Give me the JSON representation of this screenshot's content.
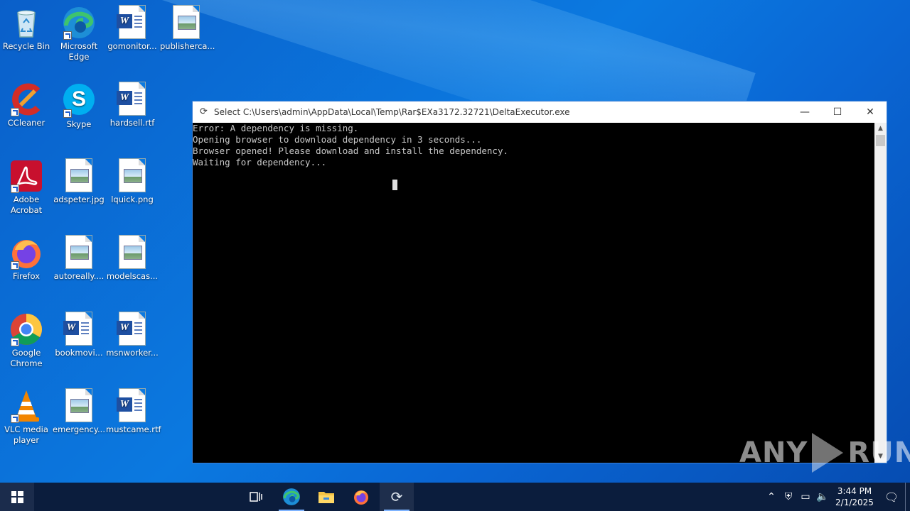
{
  "desktop": {
    "icons": [
      {
        "label": "Recycle Bin"
      },
      {
        "label": "Microsoft Edge"
      },
      {
        "label": "gomonitor..."
      },
      {
        "label": "publisherca..."
      },
      {
        "label": "CCleaner"
      },
      {
        "label": "Skype"
      },
      {
        "label": "hardsell.rtf"
      },
      {
        "label": "Adobe Acrobat"
      },
      {
        "label": "adspeter.jpg"
      },
      {
        "label": "lquick.png"
      },
      {
        "label": "Firefox"
      },
      {
        "label": "autoreally...."
      },
      {
        "label": "modelscas..."
      },
      {
        "label": "Google Chrome"
      },
      {
        "label": "bookmovi..."
      },
      {
        "label": "msnworker..."
      },
      {
        "label": "VLC media player"
      },
      {
        "label": "emergency..."
      },
      {
        "label": "mustcame.rtf"
      }
    ]
  },
  "console_window": {
    "title": "Select C:\\Users\\admin\\AppData\\Local\\Temp\\Rar$EXa3172.32721\\DeltaExecutor.exe",
    "lines": [
      "Error: A dependency is missing.",
      "Opening browser to download dependency in 3 seconds...",
      "Browser opened! Please download and install the dependency.",
      "Waiting for dependency..."
    ],
    "controls": {
      "minimize": "—",
      "maximize": "☐",
      "close": "✕"
    }
  },
  "watermark": {
    "left": "ANY",
    "right": "RUN"
  },
  "taskbar": {
    "clock_time": "3:44 PM",
    "clock_date": "2/1/2025",
    "tray_icons": [
      "chevron-up-icon",
      "security-icon",
      "network-icon",
      "volume-icon"
    ]
  },
  "colors": {
    "accent": "#0b79e0",
    "taskbar": "#0b1d3d",
    "console_bg": "#000000",
    "console_fg": "#c8c8c8"
  }
}
